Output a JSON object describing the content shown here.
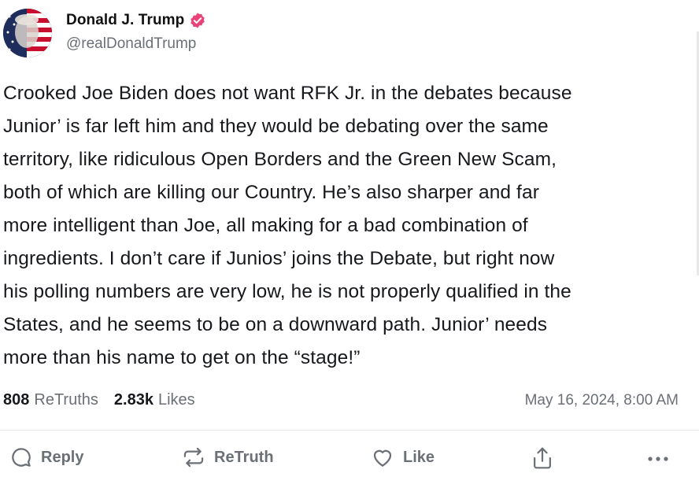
{
  "author": {
    "display_name": "Donald J. Trump",
    "handle": "@realDonaldTrump",
    "verified_icon": "verified-badge-icon",
    "verified_color": "#e9447a"
  },
  "post": {
    "lines": [
      "Crooked Joe Biden does not want RFK Jr. in the debates because",
      "Junior’ is far left him and they would be debating over the same",
      "territory, like ridiculous Open Borders and the Green New Scam,",
      "both of which are killing our Country. He’s also sharper and far",
      "more intelligent than Joe, all making for a bad combination of",
      "ingredients. I don’t care if Junios’ joins the Debate, but right now",
      "his polling numbers are very low, he is not properly qualified in the",
      "States, and he seems to be on a downward path. Junior’ needs",
      "more than his name to get on the “stage!”"
    ]
  },
  "stats": {
    "retruths_count": "808",
    "retruths_label": "ReTruths",
    "likes_count": "2.83k",
    "likes_label": "Likes",
    "timestamp": "May 16, 2024, 8:00 AM"
  },
  "actions": {
    "reply": "Reply",
    "retruth": "ReTruth",
    "like": "Like",
    "share_icon": "share-icon",
    "more_icon": "more-icon"
  },
  "colors": {
    "text": "#16181c",
    "muted": "#6b6f76",
    "divider": "#e6e8eb"
  }
}
